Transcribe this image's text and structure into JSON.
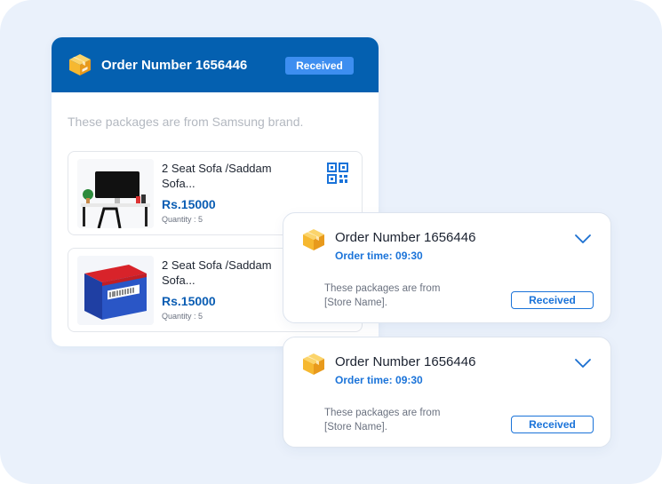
{
  "main_card": {
    "title": "Order Number 1656446",
    "status": "Received",
    "brand_note": "These packages are from Samsung brand.",
    "products": [
      {
        "name": "2 Seat Sofa /Saddam Sofa...",
        "price": "Rs.15000",
        "quantity": "Quantity : 5",
        "thumb_icon": "desk-photo"
      },
      {
        "name": "2 Seat Sofa /Saddam Sofa...",
        "price": "Rs.15000",
        "quantity": "Quantity : 5",
        "thumb_icon": "product-box-photo"
      }
    ]
  },
  "order_cards": [
    {
      "title": "Order Number 1656446",
      "time": "Order time: 09:30",
      "desc_line1": "These packages are from",
      "desc_line2": "[Store Name].",
      "status": "Received"
    },
    {
      "title": "Order Number 1656446",
      "time": "Order time: 09:30",
      "desc_line1": "These packages are from",
      "desc_line2": "[Store Name].",
      "status": "Received"
    }
  ],
  "colors": {
    "background": "#eaf1fb",
    "header_blue": "#0460b0",
    "pill_blue": "#3d8ef0",
    "accent_blue": "#1a73d9",
    "box_yellow": "#f7c23f"
  }
}
